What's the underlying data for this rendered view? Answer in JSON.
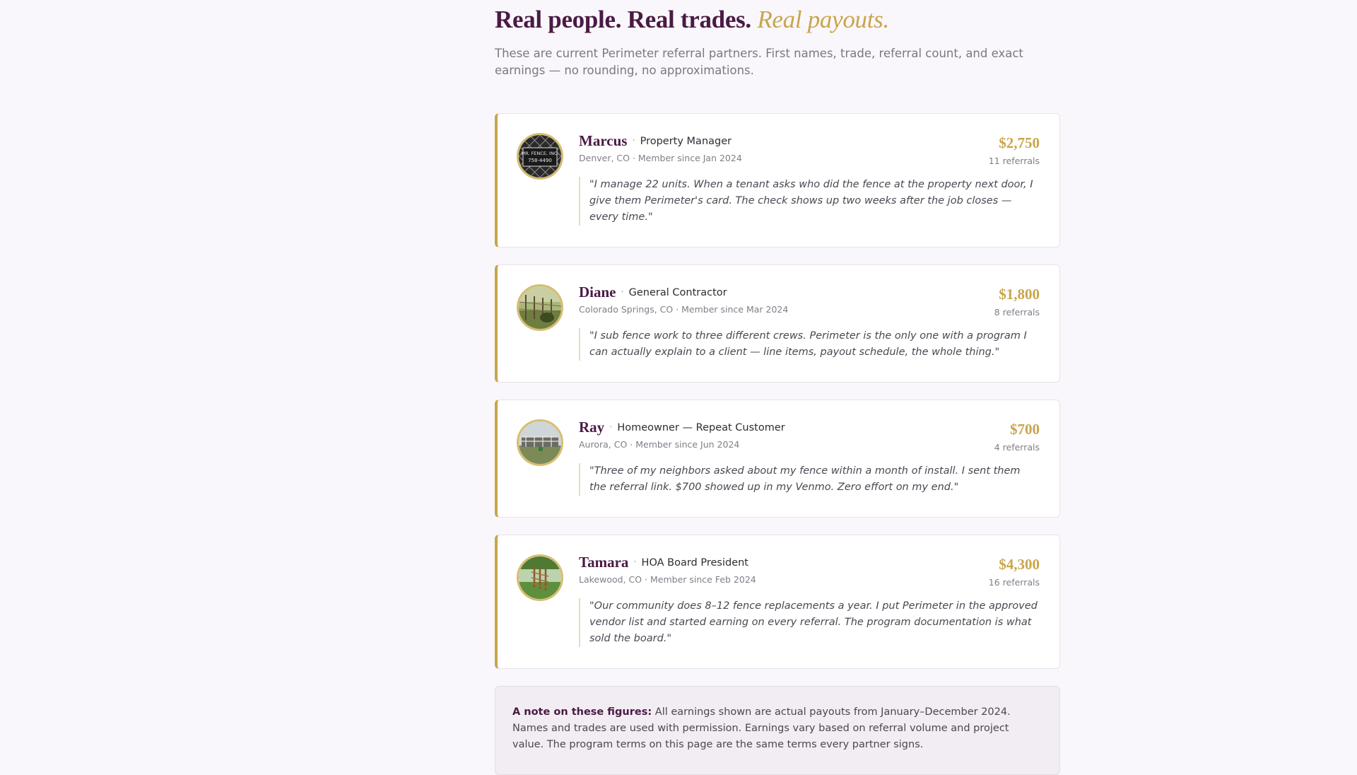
{
  "header": {
    "headline_main": "Real people. Real trades.",
    "headline_accent": "Real payouts.",
    "intro": "These are current Perimeter referral partners. First names, trade, referral count, and exact earnings — no rounding, no approximations."
  },
  "partners": [
    {
      "name": "Marcus",
      "trade": "Property Manager",
      "meta": "Denver, CO · Member since Jan 2024",
      "earnings": "$2,750",
      "referrals": "11 referrals",
      "quote": "\"I manage 22 units. When a tenant asks who did the fence at the property next door, I give them Perimeter's card. The check shows up two weeks after the job closes — every time.\"",
      "avatar_sign_line1": "MR. FENCE, INC.",
      "avatar_sign_line2": "758-4490"
    },
    {
      "name": "Diane",
      "trade": "General Contractor",
      "meta": "Colorado Springs, CO · Member since Mar 2024",
      "earnings": "$1,800",
      "referrals": "8 referrals",
      "quote": "\"I sub fence work to three different crews. Perimeter is the only one with a program I can actually explain to a client — line items, payout schedule, the whole thing.\""
    },
    {
      "name": "Ray",
      "trade": "Homeowner — Repeat Customer",
      "meta": "Aurora, CO · Member since Jun 2024",
      "earnings": "$700",
      "referrals": "4 referrals",
      "quote": "\"Three of my neighbors asked about my fence within a month of install. I sent them the referral link. $700 showed up in my Venmo. Zero effort on my end.\""
    },
    {
      "name": "Tamara",
      "trade": "HOA Board President",
      "meta": "Lakewood, CO · Member since Feb 2024",
      "earnings": "$4,300",
      "referrals": "16 referrals",
      "quote": "\"Our community does 8–12 fence replacements a year. I put Perimeter in the approved vendor list and started earning on every referral. The program documentation is what sold the board.\""
    }
  ],
  "note": {
    "label": "A note on these figures:",
    "text": "All earnings shown are actual payouts from January–December 2024. Names and trades are used with permission. Earnings vary based on referral volume and project value. The program terms on this page are the same terms every partner signs."
  },
  "colors": {
    "brand_purple": "#4a1a45",
    "gold_accent": "#c9a54c",
    "background": "#f9f7fb"
  }
}
